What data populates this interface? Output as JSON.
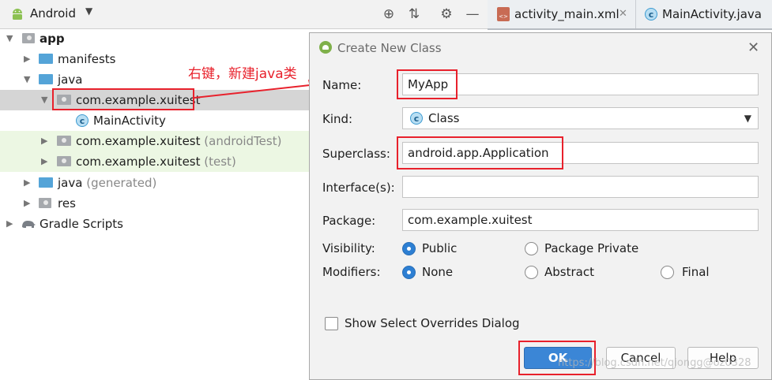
{
  "project_panel": {
    "title": "Android",
    "tree": {
      "app": "app",
      "manifests": "manifests",
      "java": "java",
      "package_main": "com.example.xuitest",
      "main_activity": "MainActivity",
      "package_android_test": "com.example.xuitest",
      "android_test_suffix": "(androidTest)",
      "package_test": "com.example.xuitest",
      "test_suffix": "(test)",
      "java_generated": "java",
      "generated_suffix": "(generated)",
      "res": "res",
      "gradle": "Gradle Scripts"
    }
  },
  "editor_tabs": [
    {
      "label": "activity_main.xml",
      "icon": "xml-file-icon"
    },
    {
      "label": "MainActivity.java",
      "icon": "class-icon"
    }
  ],
  "annotation": {
    "text": "右键，新建java类",
    "color": "#e8212c"
  },
  "dialog": {
    "title": "Create New Class",
    "fields": {
      "name_label": "Name:",
      "name_value": "MyApp",
      "kind_label": "Kind:",
      "kind_value": "Class",
      "superclass_label": "Superclass:",
      "superclass_value": "android.app.Application",
      "interfaces_label": "Interface(s):",
      "interfaces_value": "",
      "package_label": "Package:",
      "package_value": "com.example.xuitest"
    },
    "visibility": {
      "label": "Visibility:",
      "options": [
        "Public",
        "Package Private"
      ],
      "selected": "Public"
    },
    "modifiers": {
      "label": "Modifiers:",
      "options": [
        "None",
        "Abstract",
        "Final"
      ],
      "selected": "None"
    },
    "overrides_label": "Show Select Overrides Dialog",
    "buttons": {
      "ok": "OK",
      "cancel": "Cancel",
      "help": "Help"
    }
  },
  "watermark": "https://blog.csdn.net/qiongg@oz0328",
  "colors": {
    "accent": "#3b86d6",
    "annotation_red": "#e8212c",
    "selection": "#d5d5d5",
    "test_row": "#ecf7e3"
  }
}
